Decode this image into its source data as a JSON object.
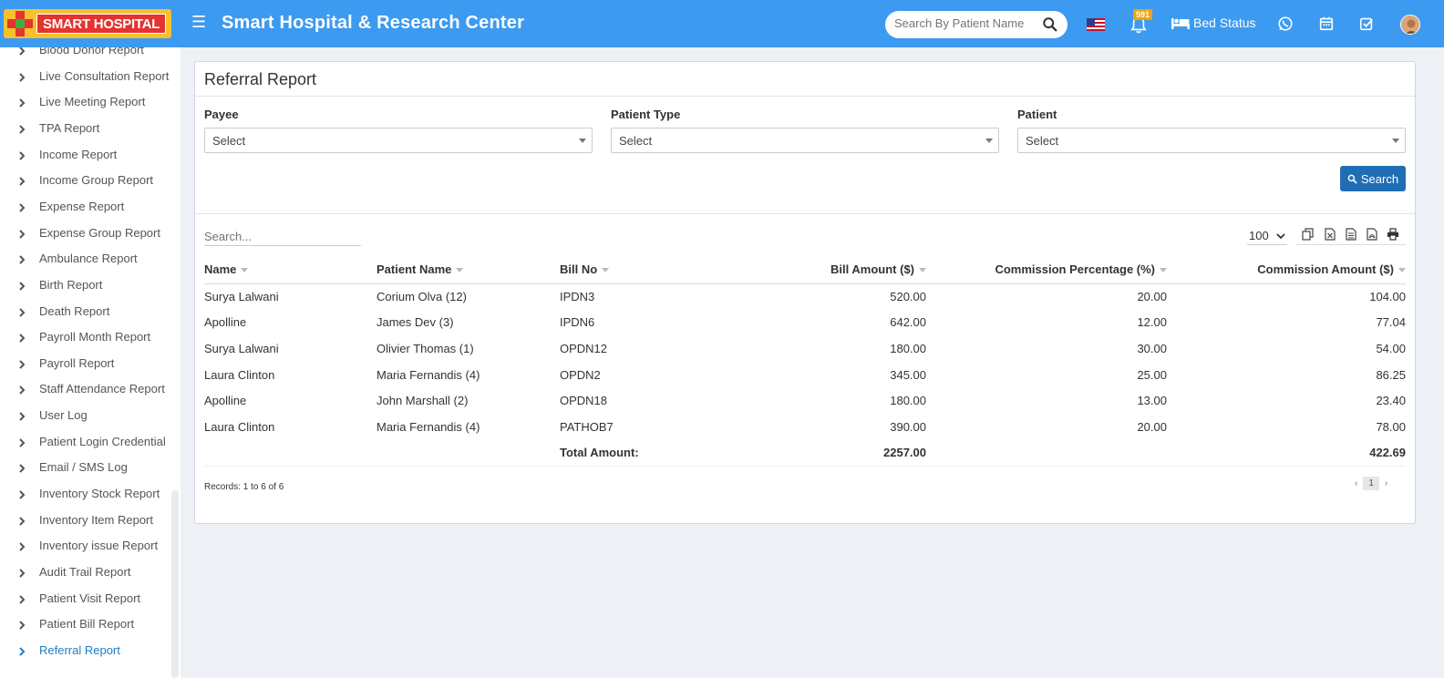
{
  "header": {
    "logo_text": "SMART HOSPITAL",
    "app_title": "Smart Hospital & Research Center",
    "search_placeholder": "Search By Patient Name",
    "notification_count": "591",
    "bed_status_label": "Bed Status",
    "brand_color": "#3c9af0"
  },
  "sidebar": {
    "items": [
      {
        "label": "Blood Donor Report"
      },
      {
        "label": "Live Consultation Report"
      },
      {
        "label": "Live Meeting Report"
      },
      {
        "label": "TPA Report"
      },
      {
        "label": "Income Report"
      },
      {
        "label": "Income Group Report"
      },
      {
        "label": "Expense Report"
      },
      {
        "label": "Expense Group Report"
      },
      {
        "label": "Ambulance Report"
      },
      {
        "label": "Birth Report"
      },
      {
        "label": "Death Report"
      },
      {
        "label": "Payroll Month Report"
      },
      {
        "label": "Payroll Report"
      },
      {
        "label": "Staff Attendance Report"
      },
      {
        "label": "User Log"
      },
      {
        "label": "Patient Login Credential"
      },
      {
        "label": "Email / SMS Log"
      },
      {
        "label": "Inventory Stock Report"
      },
      {
        "label": "Inventory Item Report"
      },
      {
        "label": "Inventory issue Report"
      },
      {
        "label": "Audit Trail Report"
      },
      {
        "label": "Patient Visit Report"
      },
      {
        "label": "Patient Bill Report"
      },
      {
        "label": "Referral Report"
      }
    ],
    "active_label": "Referral Report"
  },
  "report": {
    "title": "Referral Report",
    "filters": {
      "payee_label": "Payee",
      "payee_value": "Select",
      "patient_type_label": "Patient Type",
      "patient_type_value": "Select",
      "patient_label": "Patient",
      "patient_value": "Select"
    },
    "search_button": "Search",
    "table_search_placeholder": "Search...",
    "page_length": "100",
    "columns": [
      "Name",
      "Patient Name",
      "Bill No",
      "Bill Amount ($)",
      "Commission Percentage (%)",
      "Commission Amount ($)"
    ],
    "rows": [
      [
        "Surya Lalwani",
        "Corium Olva (12)",
        "IPDN3",
        "520.00",
        "20.00",
        "104.00"
      ],
      [
        "Apolline",
        "James Dev (3)",
        "IPDN6",
        "642.00",
        "12.00",
        "77.04"
      ],
      [
        "Surya Lalwani",
        "Olivier Thomas (1)",
        "OPDN12",
        "180.00",
        "30.00",
        "54.00"
      ],
      [
        "Laura Clinton",
        "Maria Fernandis (4)",
        "OPDN2",
        "345.00",
        "25.00",
        "86.25"
      ],
      [
        "Apolline",
        "John Marshall (2)",
        "OPDN18",
        "180.00",
        "13.00",
        "23.40"
      ],
      [
        "Laura Clinton",
        "Maria Fernandis (4)",
        "PATHOB7",
        "390.00",
        "20.00",
        "78.00"
      ]
    ],
    "total": {
      "label": "Total Amount:",
      "bill_amount": "2257.00",
      "commission_amount": "422.69"
    },
    "records_text": "Records: 1 to 6 of 6",
    "current_page": "1"
  }
}
